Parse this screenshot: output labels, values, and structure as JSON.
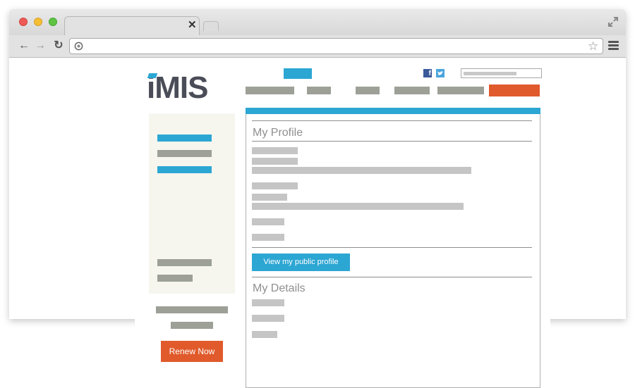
{
  "page": {
    "logo_text": "iMIS",
    "section_profile_title": "My Profile",
    "profile_button_label": "View my public profile",
    "section_details_title": "My Details",
    "renew_button_label": "Renew Now"
  },
  "colors": {
    "brand_blue": "#2ca6d3",
    "accent_orange": "#e05a2b",
    "placeholder_gray": "#9ca097",
    "sidebar_bg": "#f6f6ef",
    "logo_gray": "#4a4d57"
  },
  "icons": {
    "social": [
      "facebook-icon",
      "twitter-icon"
    ],
    "browser": [
      "back-icon",
      "forward-icon",
      "reload-icon",
      "globe-icon",
      "star-icon",
      "menu-icon",
      "fullscreen-icon",
      "tab-close-icon"
    ]
  }
}
